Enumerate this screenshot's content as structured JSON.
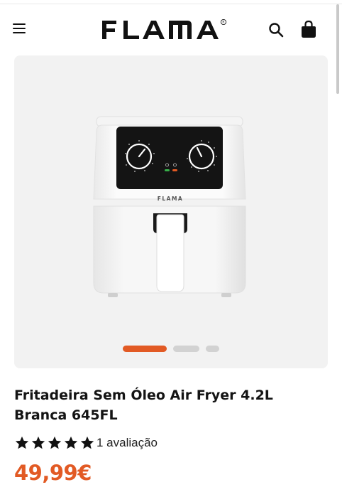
{
  "header": {
    "brand": "FLAMA",
    "menu_icon": "hamburger-menu-icon",
    "search_icon": "search-icon",
    "cart_icon": "shopping-bag-icon"
  },
  "product": {
    "title": "Fritadeira Sem Óleo Air Fryer 4.2L Branca 645FL",
    "rating": 5,
    "rating_max": 5,
    "reviews_text": "1 avaliação",
    "price": "49,99€",
    "device_brand": "FLAMA"
  },
  "gallery": {
    "slides": 3,
    "active_slide": 1
  },
  "colors": {
    "accent": "#e25a24",
    "text": "#141414",
    "gallery_bg": "#f2f2f2",
    "inactive_dot": "#d2d2d2"
  }
}
